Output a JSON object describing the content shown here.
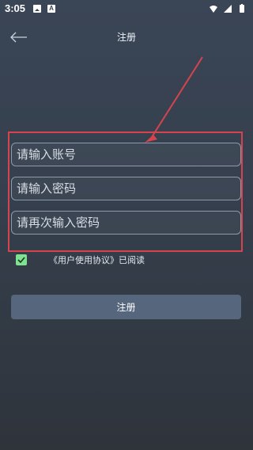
{
  "status_bar": {
    "time": "3:05",
    "notification_a_label": "A"
  },
  "header": {
    "title": "注册"
  },
  "form": {
    "account_placeholder": "请输入账号",
    "password_placeholder": "请输入密码",
    "confirm_password_placeholder": "请再次输入密码"
  },
  "agreement": {
    "checked": true,
    "text": "《用户使用协议》已阅读"
  },
  "actions": {
    "register_label": "注册"
  },
  "colors": {
    "annotation": "#d5444c",
    "checkbox": "#7de38f",
    "button": "#56677d"
  }
}
